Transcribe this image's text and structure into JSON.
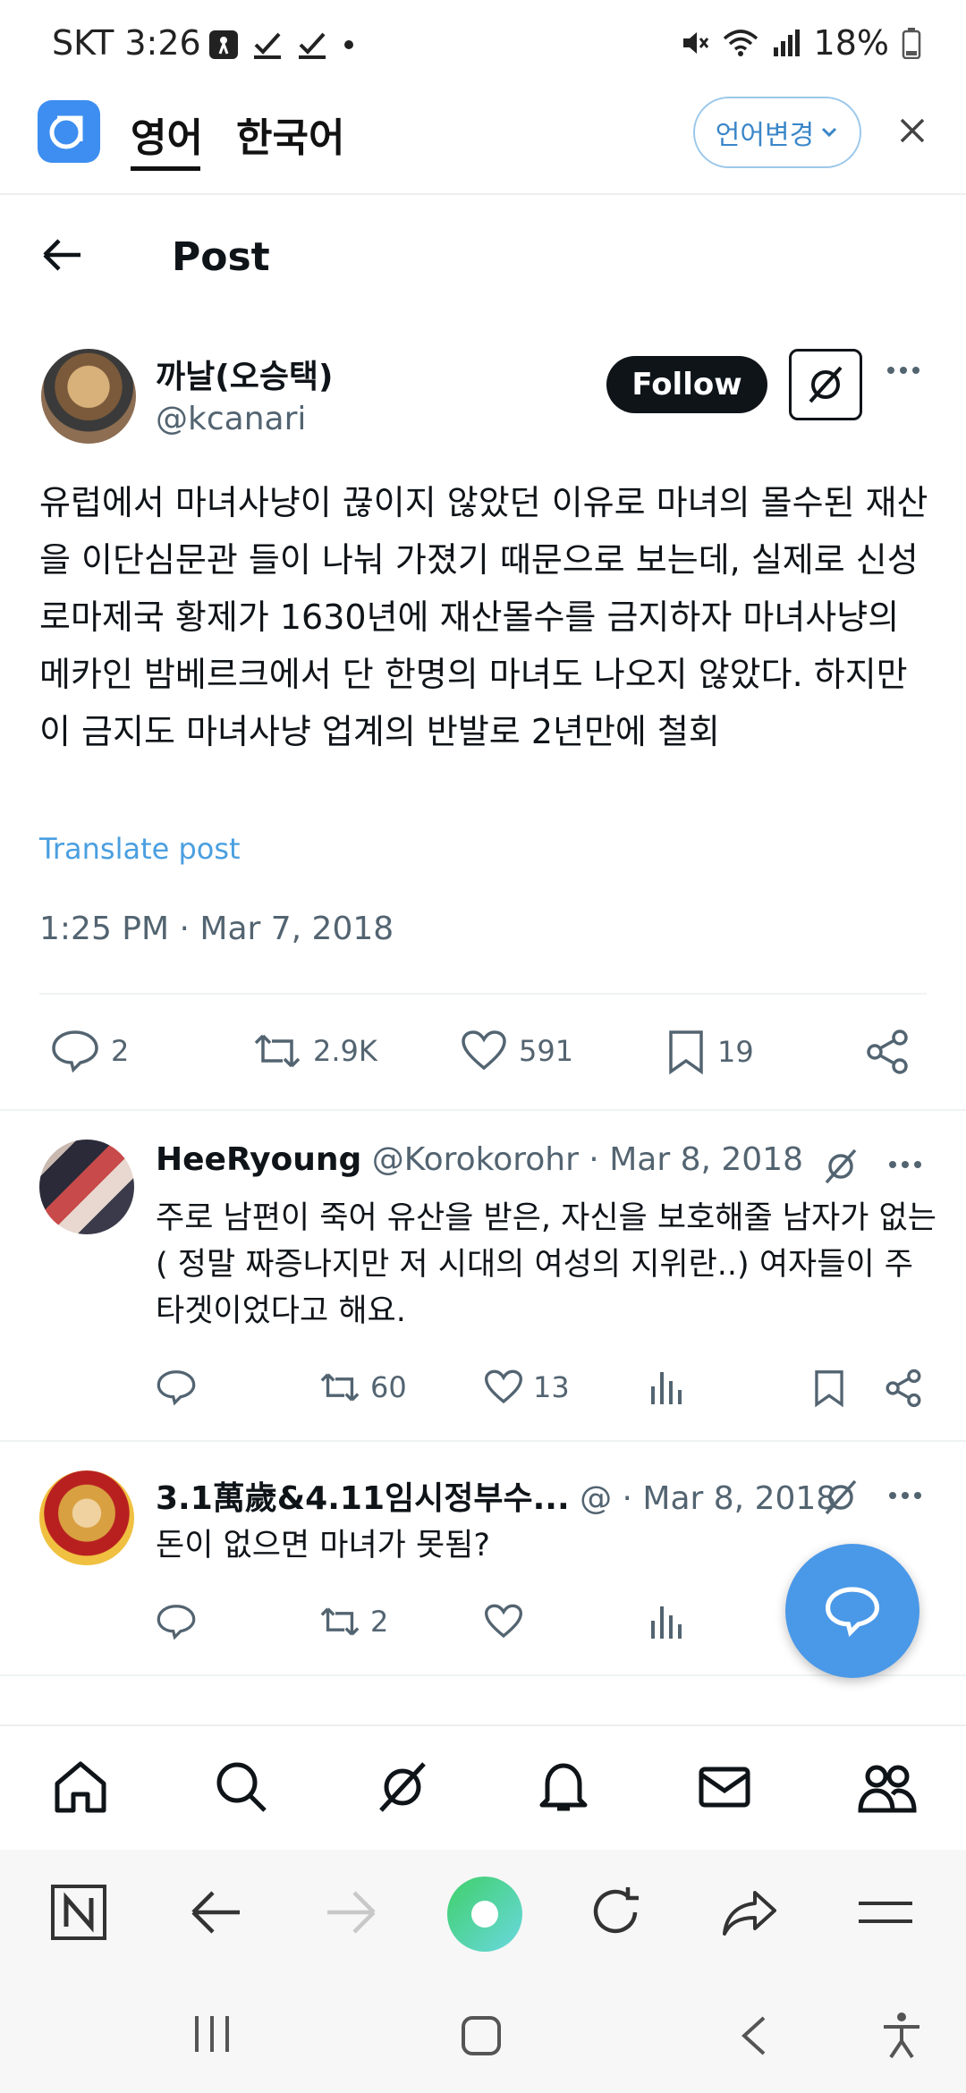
{
  "status_bar": {
    "time": "SKT 3:26",
    "battery": "18%"
  },
  "translate_bar": {
    "tab_source": "영어",
    "tab_target": "한국어",
    "change_language": "언어변경"
  },
  "header": {
    "title": "Post"
  },
  "post": {
    "author_name": "까날(오승택)",
    "author_handle": "@kcanari",
    "follow_label": "Follow",
    "text": "유럽에서 마녀사냥이 끊이지 않았던 이유로 마녀의 몰수된 재산을 이단심문관 들이 나눠 가졌기 때문으로 보는데, 실제로 신성로마제국 황제가 1630년에 재산몰수를 금지하자 마녀사냥의 메카인 밤베르크에서 단 한명의 마녀도 나오지 않았다. 하지만 이 금지도 마녀사냥 업계의 반발로 2년만에 철회",
    "translate_label": "Translate post",
    "timestamp": "1:25 PM · Mar 7, 2018",
    "stats": {
      "replies": "2",
      "reposts": "2.9K",
      "likes": "591",
      "bookmarks": "19"
    }
  },
  "replies": [
    {
      "name": "HeeRyoung",
      "handle_date": "@Korokorohr · Mar 8, 2018",
      "text": "주로 남편이 죽어 유산을 받은, 자신을 보호해줄 남자가 없는( 정말 짜증나지만 저 시대의 여성의 지위란..) 여자들이 주 타겟이었다고 해요.",
      "reposts": "60",
      "likes": "13"
    },
    {
      "name": "3.1萬歲&4.11임시정부수...",
      "handle_date": "@ · Mar 8, 2018",
      "text": "돈이 없으면 마녀가 못됨?",
      "reposts": "2",
      "likes": ""
    }
  ],
  "colors": {
    "accent": "#4a98e8",
    "text": "#0f1419",
    "muted": "#536471",
    "link": "#4a9fe0"
  }
}
